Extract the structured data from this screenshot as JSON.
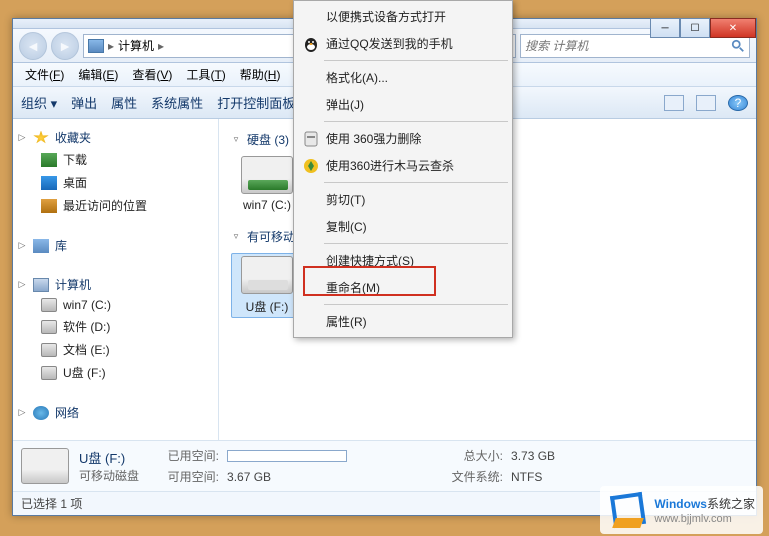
{
  "window": {
    "breadcrumb": {
      "item": "计算机",
      "sep1": "▸",
      "sep2": "▸"
    },
    "search_placeholder": "搜索 计算机"
  },
  "menubar": {
    "items": [
      {
        "label": "文件",
        "key": "F"
      },
      {
        "label": "编辑",
        "key": "E"
      },
      {
        "label": "查看",
        "key": "V"
      },
      {
        "label": "工具",
        "key": "T"
      },
      {
        "label": "帮助",
        "key": "H"
      }
    ]
  },
  "toolbar": {
    "organize": "组织 ▾",
    "eject": "弹出",
    "properties": "属性",
    "sys_properties": "系统属性",
    "control_panel": "打开控制面板"
  },
  "sidebar": {
    "favorites": {
      "head": "收藏夹",
      "items": [
        "下载",
        "桌面",
        "最近访问的位置"
      ]
    },
    "libraries": {
      "head": "库"
    },
    "computer": {
      "head": "计算机",
      "items": [
        "win7 (C:)",
        "软件 (D:)",
        "文档 (E:)",
        "U盘 (F:)"
      ]
    },
    "network": {
      "head": "网络"
    }
  },
  "content": {
    "cat_hdd": "硬盘 (3)",
    "cat_removable": "有可移动",
    "hdd_item": "win7 (C:)",
    "usb_item": "U盘 (F:)"
  },
  "context_menu": {
    "items": [
      {
        "label": "以便携式设备方式打开",
        "icon": null
      },
      {
        "label": "通过QQ发送到我的手机",
        "icon": "qq"
      },
      {
        "sep": true
      },
      {
        "label": "格式化(A)..."
      },
      {
        "label": "弹出(J)"
      },
      {
        "sep": true
      },
      {
        "label": "使用 360强力删除",
        "icon": "360del"
      },
      {
        "label": "使用360进行木马云查杀",
        "icon": "360scan"
      },
      {
        "sep": true
      },
      {
        "label": "剪切(T)"
      },
      {
        "label": "复制(C)"
      },
      {
        "sep": true
      },
      {
        "label": "创建快捷方式(S)"
      },
      {
        "label": "重命名(M)"
      },
      {
        "sep": true
      },
      {
        "label": "属性(R)"
      }
    ]
  },
  "status": {
    "drive_name": "U盘 (F:)",
    "drive_type": "可移动磁盘",
    "used_label": "已用空间:",
    "free_label": "可用空间:",
    "free_value": "3.67 GB",
    "total_label": "总大小:",
    "total_value": "3.73 GB",
    "fs_label": "文件系统:",
    "fs_value": "NTFS",
    "selection": "已选择 1 项"
  },
  "watermark": {
    "brand1": "Windows",
    "brand2": "系统之家",
    "url": "www.bjjmlv.com"
  }
}
